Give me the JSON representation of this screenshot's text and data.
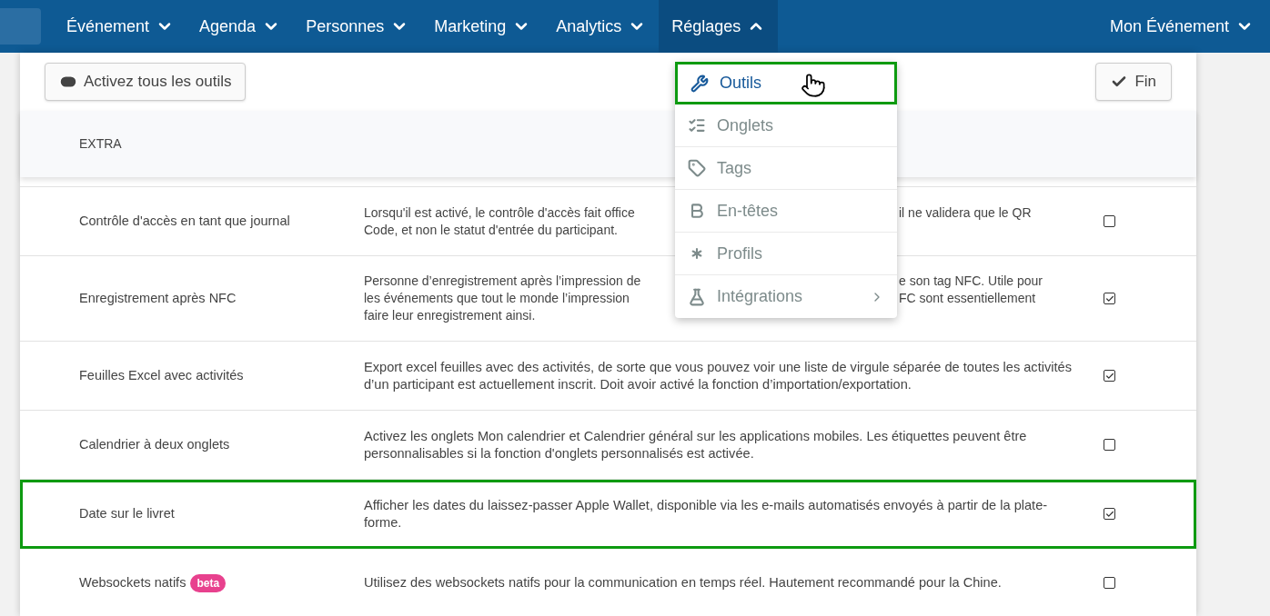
{
  "nav": {
    "items": [
      {
        "label": "Événement",
        "open": false
      },
      {
        "label": "Agenda",
        "open": false
      },
      {
        "label": "Personnes",
        "open": false
      },
      {
        "label": "Marketing",
        "open": false
      },
      {
        "label": "Analytics",
        "open": false
      },
      {
        "label": "Réglages",
        "open": true
      }
    ],
    "account": {
      "label": "Mon Événement",
      "open": false
    }
  },
  "toolbar": {
    "toggle_all": "Activez tous les outils",
    "done": "Fin"
  },
  "section": {
    "title": "EXTRA"
  },
  "rows": [
    {
      "name": "Contrôle d'accès en tant que journal",
      "lines": [
        {
          "left": "Lorsqu'il est activé, le contrôle d'accès fait office",
          "right": "il ne validera que le QR"
        },
        {
          "left": "Code, et non le statut d'entrée du participant."
        }
      ],
      "checked": false,
      "highlighted": false
    },
    {
      "name": "Enregistrement après NFC",
      "lines": [
        {
          "left": "Personne d’enregistrement après l’impression de",
          "right": "e son tag NFC. Utile pour"
        },
        {
          "left": "les événements que tout le monde l’impression",
          "right": "FC sont essentiellement"
        },
        {
          "left": "faire leur enregistrement ainsi."
        }
      ],
      "checked": true,
      "highlighted": false
    },
    {
      "name": "Feuilles Excel avec activités",
      "description": "Export excel feuilles avec des activités, de sorte que vous pouvez voir une liste de virgule séparée de toutes les activités d’un participant est actuellement inscrit. Doit avoir activé la fonction d’importation/exportation.",
      "checked": true,
      "highlighted": false
    },
    {
      "name": "Calendrier à deux onglets",
      "description": "Activez les onglets Mon calendrier et Calendrier général sur les applications mobiles. Les étiquettes peuvent être personnalisables si la fonction d'onglets personnalisés est activée.",
      "checked": false,
      "highlighted": false
    },
    {
      "name": "Date sur le livret",
      "description": "Afficher les dates du laissez-passer Apple Wallet, disponible via les e-mails automatisés envoyés à partir de la plate-forme.",
      "checked": true,
      "highlighted": true
    },
    {
      "name": "Websockets natifs",
      "badge": "beta",
      "description": "Utilisez des websockets natifs pour la communication en temps réel. Hautement recommandé pour la Chine.",
      "checked": false,
      "highlighted": false
    }
  ],
  "menu": {
    "items": [
      {
        "kind": "wrench",
        "label": "Outils",
        "selected": true,
        "highlighted": true,
        "submenu": false
      },
      {
        "kind": "checklist",
        "label": "Onglets",
        "selected": false,
        "highlighted": false,
        "submenu": false
      },
      {
        "kind": "tag",
        "label": "Tags",
        "selected": false,
        "highlighted": false,
        "submenu": false
      },
      {
        "kind": "bold",
        "label": "En-têtes",
        "selected": false,
        "highlighted": false,
        "submenu": false
      },
      {
        "kind": "asterisk",
        "label": "Profils",
        "selected": false,
        "highlighted": false,
        "submenu": false
      },
      {
        "kind": "flask",
        "label": "Intégrations",
        "selected": false,
        "highlighted": false,
        "submenu": true
      }
    ]
  }
}
